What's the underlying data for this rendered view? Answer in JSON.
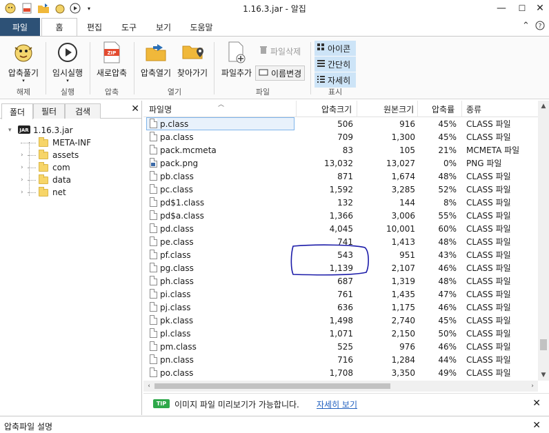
{
  "window": {
    "title": "1.16.3.jar - 알집"
  },
  "menu": {
    "file": "파일",
    "tabs": [
      "홈",
      "편집",
      "도구",
      "보기",
      "도움말"
    ],
    "active_tab": 0
  },
  "ribbon": {
    "extract": {
      "label": "압축풀기",
      "group": "해제"
    },
    "run": {
      "label": "임시실행",
      "group": "실행"
    },
    "new_archive": {
      "label": "새로압축",
      "group": "압축"
    },
    "open_archive": {
      "label": "압축열기"
    },
    "goto": {
      "label": "찾아가기"
    },
    "open_group": "열기",
    "add_file": {
      "label": "파일추가"
    },
    "delete_file": {
      "label": "파일삭제"
    },
    "rename": {
      "label": "이름변경"
    },
    "file_group": "파일",
    "view_icon": "아이콘",
    "view_simple": "간단히",
    "view_detail": "자세히",
    "view_group": "표시",
    "zip_badge": "ZIP"
  },
  "left_panel": {
    "tabs": [
      "폴더",
      "필터",
      "검색"
    ],
    "root": "1.16.3.jar",
    "jar_badge": "JAR",
    "folders": [
      "META-INF",
      "assets",
      "com",
      "data",
      "net"
    ]
  },
  "columns": {
    "name": "파일명",
    "compressed": "압축크기",
    "original": "원본크기",
    "ratio": "압축률",
    "type": "종류"
  },
  "files": [
    {
      "name": "p.class",
      "compressed": "506",
      "original": "916",
      "ratio": "45%",
      "type": "CLASS 파일"
    },
    {
      "name": "pa.class",
      "compressed": "709",
      "original": "1,300",
      "ratio": "45%",
      "type": "CLASS 파일"
    },
    {
      "name": "pack.mcmeta",
      "compressed": "83",
      "original": "105",
      "ratio": "21%",
      "type": "MCMETA 파일"
    },
    {
      "name": "pack.png",
      "compressed": "13,032",
      "original": "13,027",
      "ratio": "0%",
      "type": "PNG 파일"
    },
    {
      "name": "pb.class",
      "compressed": "871",
      "original": "1,674",
      "ratio": "48%",
      "type": "CLASS 파일"
    },
    {
      "name": "pc.class",
      "compressed": "1,592",
      "original": "3,285",
      "ratio": "52%",
      "type": "CLASS 파일"
    },
    {
      "name": "pd$1.class",
      "compressed": "132",
      "original": "144",
      "ratio": "8%",
      "type": "CLASS 파일"
    },
    {
      "name": "pd$a.class",
      "compressed": "1,366",
      "original": "3,006",
      "ratio": "55%",
      "type": "CLASS 파일"
    },
    {
      "name": "pd.class",
      "compressed": "4,045",
      "original": "10,001",
      "ratio": "60%",
      "type": "CLASS 파일"
    },
    {
      "name": "pe.class",
      "compressed": "741",
      "original": "1,413",
      "ratio": "48%",
      "type": "CLASS 파일"
    },
    {
      "name": "pf.class",
      "compressed": "543",
      "original": "951",
      "ratio": "43%",
      "type": "CLASS 파일"
    },
    {
      "name": "pg.class",
      "compressed": "1,139",
      "original": "2,107",
      "ratio": "46%",
      "type": "CLASS 파일"
    },
    {
      "name": "ph.class",
      "compressed": "687",
      "original": "1,319",
      "ratio": "48%",
      "type": "CLASS 파일"
    },
    {
      "name": "pi.class",
      "compressed": "761",
      "original": "1,435",
      "ratio": "47%",
      "type": "CLASS 파일"
    },
    {
      "name": "pj.class",
      "compressed": "636",
      "original": "1,175",
      "ratio": "46%",
      "type": "CLASS 파일"
    },
    {
      "name": "pk.class",
      "compressed": "1,498",
      "original": "2,740",
      "ratio": "45%",
      "type": "CLASS 파일"
    },
    {
      "name": "pl.class",
      "compressed": "1,071",
      "original": "2,150",
      "ratio": "50%",
      "type": "CLASS 파일"
    },
    {
      "name": "pm.class",
      "compressed": "525",
      "original": "976",
      "ratio": "46%",
      "type": "CLASS 파일"
    },
    {
      "name": "pn.class",
      "compressed": "716",
      "original": "1,284",
      "ratio": "44%",
      "type": "CLASS 파일"
    },
    {
      "name": "po.class",
      "compressed": "1,708",
      "original": "3,350",
      "ratio": "49%",
      "type": "CLASS 파일"
    }
  ],
  "selected_index": 0,
  "tip": {
    "badge": "TIP",
    "text": "이미지 파일 미리보기가 가능합니다.",
    "link": "자세히 보기"
  },
  "status": {
    "text": "압축파일 설명"
  },
  "colors": {
    "file_tab_bg": "#2d5176",
    "accent": "#1f5fbf",
    "tip_badge": "#2ea84a",
    "annotation": "#1a1aa8"
  }
}
